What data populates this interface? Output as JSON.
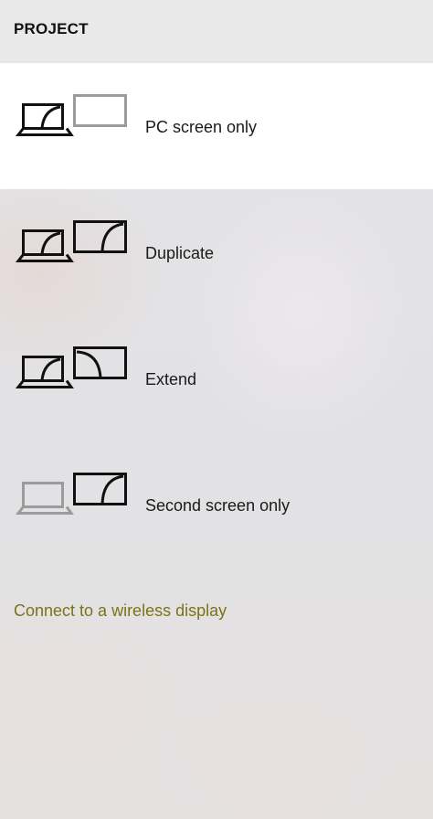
{
  "panel": {
    "title": "PROJECT"
  },
  "options": [
    {
      "label": "PC screen only",
      "icon": "pc-screen-only-icon",
      "selected": true
    },
    {
      "label": "Duplicate",
      "icon": "duplicate-icon",
      "selected": false
    },
    {
      "label": "Extend",
      "icon": "extend-icon",
      "selected": false
    },
    {
      "label": "Second screen only",
      "icon": "second-screen-only-icon",
      "selected": false
    }
  ],
  "links": {
    "connect_wireless": "Connect to a wireless display"
  },
  "colors": {
    "accent_link": "#7a7318",
    "selected_background": "#ffffff",
    "icon_active": "#111111",
    "icon_inactive": "#9b9b9b"
  }
}
